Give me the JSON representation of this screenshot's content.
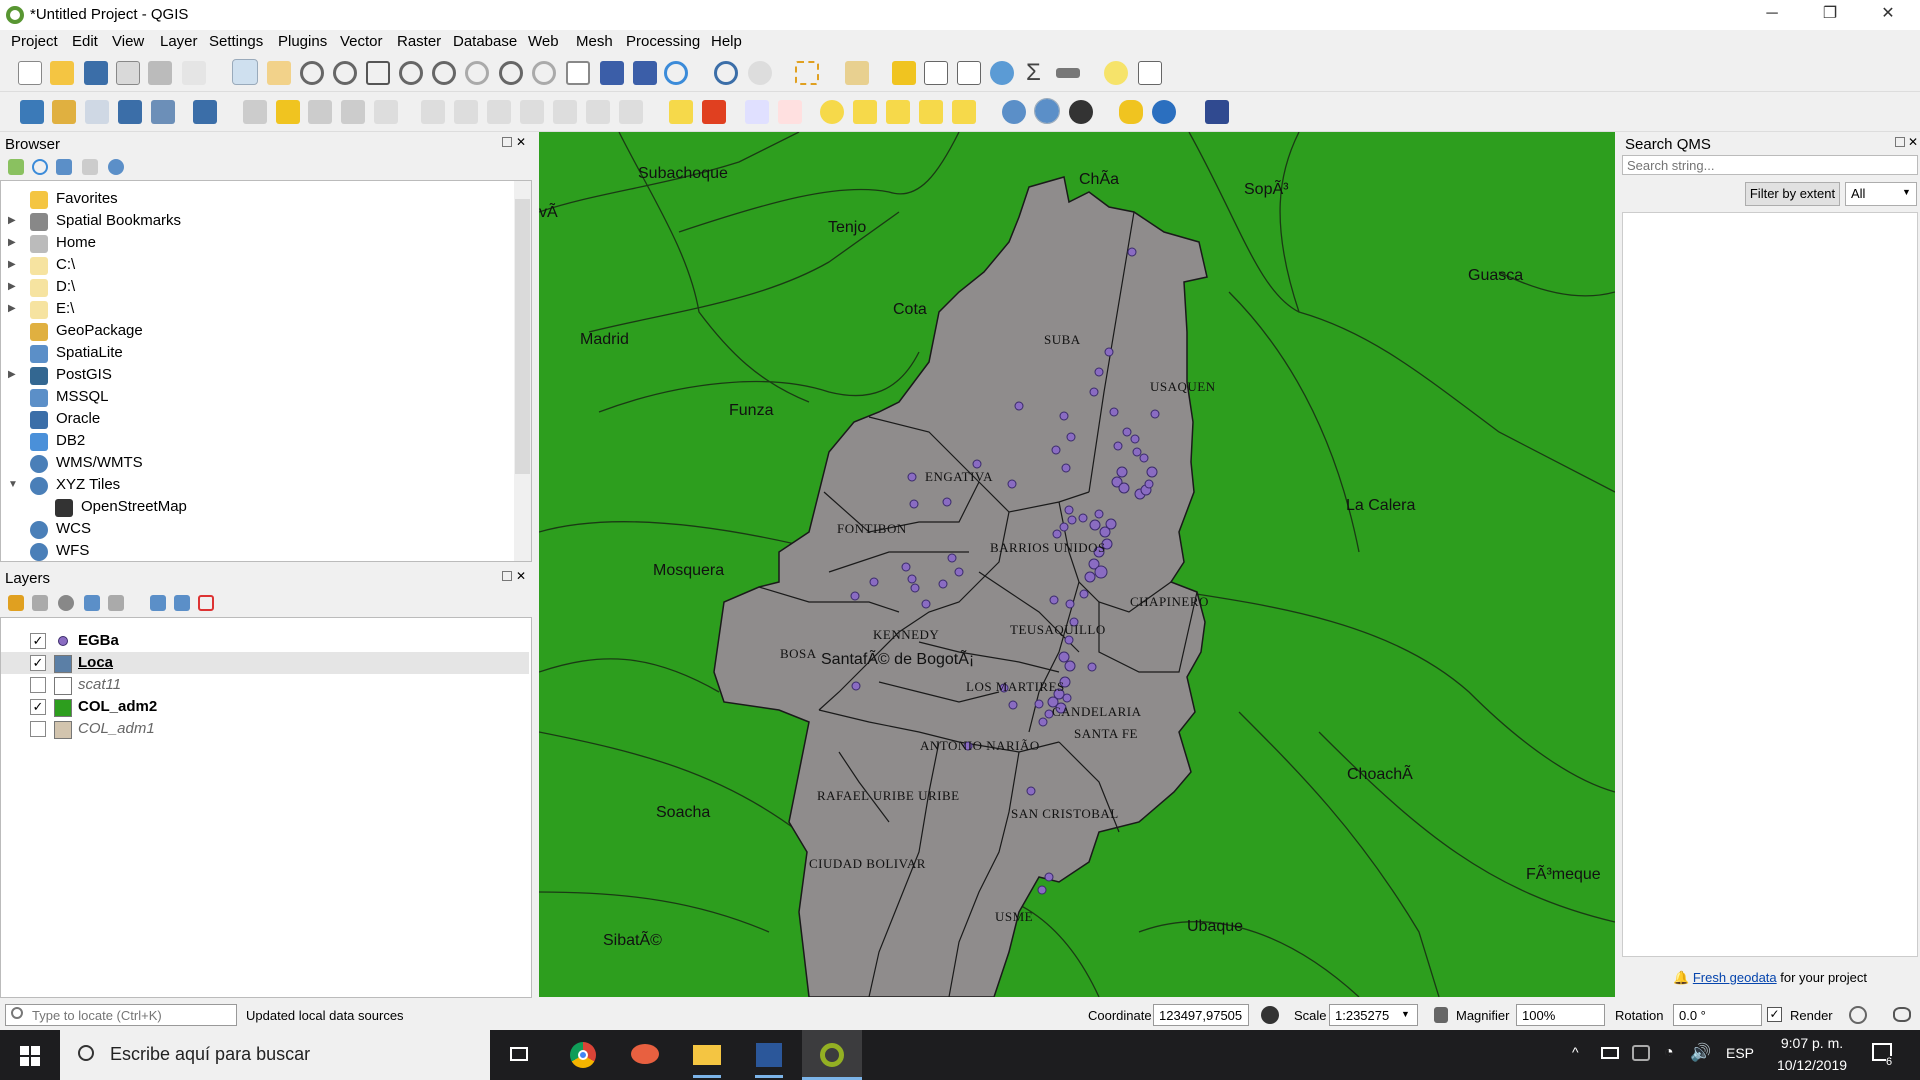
{
  "window": {
    "title": "*Untitled Project - QGIS",
    "minimize": "─",
    "maximize": "❐",
    "close": "✕"
  },
  "menu": [
    "Project",
    "Edit",
    "View",
    "Layer",
    "Settings",
    "Plugins",
    "Vector",
    "Raster",
    "Database",
    "Web",
    "Mesh",
    "Processing",
    "Help"
  ],
  "browser": {
    "title": "Browser",
    "items": [
      {
        "label": "Favorites",
        "icon": "star-icon",
        "expand": false
      },
      {
        "label": "Spatial Bookmarks",
        "icon": "bookmark-icon",
        "expand": true
      },
      {
        "label": "Home",
        "icon": "home-folder-icon",
        "expand": true
      },
      {
        "label": "C:\\",
        "icon": "folder-icon",
        "expand": true
      },
      {
        "label": "D:\\",
        "icon": "folder-icon",
        "expand": true
      },
      {
        "label": "E:\\",
        "icon": "folder-icon",
        "expand": true
      },
      {
        "label": "GeoPackage",
        "icon": "geopackage-icon",
        "expand": false
      },
      {
        "label": "SpatiaLite",
        "icon": "spatialite-icon",
        "expand": false
      },
      {
        "label": "PostGIS",
        "icon": "postgis-icon",
        "expand": true
      },
      {
        "label": "MSSQL",
        "icon": "mssql-icon",
        "expand": false
      },
      {
        "label": "Oracle",
        "icon": "oracle-icon",
        "expand": false
      },
      {
        "label": "DB2",
        "icon": "db2-icon",
        "expand": false
      },
      {
        "label": "WMS/WMTS",
        "icon": "globe-icon",
        "expand": false
      },
      {
        "label": "XYZ Tiles",
        "icon": "globe-icon",
        "expand": "open"
      },
      {
        "label": "OpenStreetMap",
        "icon": "tiles-icon",
        "expand": false,
        "child": true
      },
      {
        "label": "WCS",
        "icon": "globe-icon",
        "expand": false
      },
      {
        "label": "WFS",
        "icon": "globe-icon",
        "expand": false
      }
    ]
  },
  "layers": {
    "title": "Layers",
    "items": [
      {
        "label": "EGBa",
        "checked": "✓",
        "swatch": "point-purple",
        "bold": true
      },
      {
        "label": "Loca",
        "checked": "✓",
        "swatch": "#5b7fa6",
        "bold": true,
        "underline": true
      },
      {
        "label": "scat11",
        "checked": "",
        "swatch": "#ffffff",
        "italic": true
      },
      {
        "label": "COL_adm2",
        "checked": "✓",
        "swatch": "#2d9e1e",
        "bold": true
      },
      {
        "label": "COL_adm1",
        "checked": "",
        "swatch": "#d2c4ae",
        "italic": true
      }
    ]
  },
  "qms": {
    "title": "Search QMS",
    "placeholder": "Search string...",
    "filter_button": "Filter by extent",
    "filter_select": "All",
    "footer_link": "Fresh geodata",
    "footer_text": " for your project"
  },
  "map_labels": [
    "Subachoque",
    "ChÃ­a",
    "SopÃ³",
    "vÃ­",
    "Tenjo",
    "Guasca",
    "Cota",
    "Madrid",
    "SUBA",
    "USAQUEN",
    "Funza",
    "ENGATIVA",
    "La Calera",
    "FONTIBON",
    "BARRIOS UNIDOS",
    "Mosquera",
    "CHAPINERO",
    "KENNEDY",
    "TEUSAQUILLO",
    "BOSA",
    "SantafÃ© de BogotÃ¡",
    "LOS MARTIRES",
    "CANDELARIA",
    "SANTA FE",
    "ANTONIO NARIÃO",
    "ChoachÃ­",
    "RAFAEL URIBE URIBE",
    "Soacha",
    "SAN CRISTOBAL",
    "CIUDAD BOLIVAR",
    "FÃ³meque",
    "USME",
    "Ubaque",
    "SibatÃ©"
  ],
  "status": {
    "locate_placeholder": "Type to locate (Ctrl+K)",
    "message": "Updated local data sources",
    "coordinate_label": "Coordinate",
    "coordinate": "123497,97505",
    "scale_label": "Scale",
    "scale": "1:235275",
    "magnifier_label": "Magnifier",
    "magnifier": "100%",
    "rotation_label": "Rotation",
    "rotation": "0.0 °",
    "render_label": "Render",
    "render_checked": "✓"
  },
  "taskbar": {
    "search": "Escribe aquí para buscar",
    "lang": "ESP",
    "time": "9:07 p. m.",
    "date": "10/12/2019",
    "notif": "6"
  },
  "colors": {
    "land": "#2d9e1e",
    "district": "#8f8c8c",
    "point": "#8a6cc2",
    "accent": "#589632"
  }
}
